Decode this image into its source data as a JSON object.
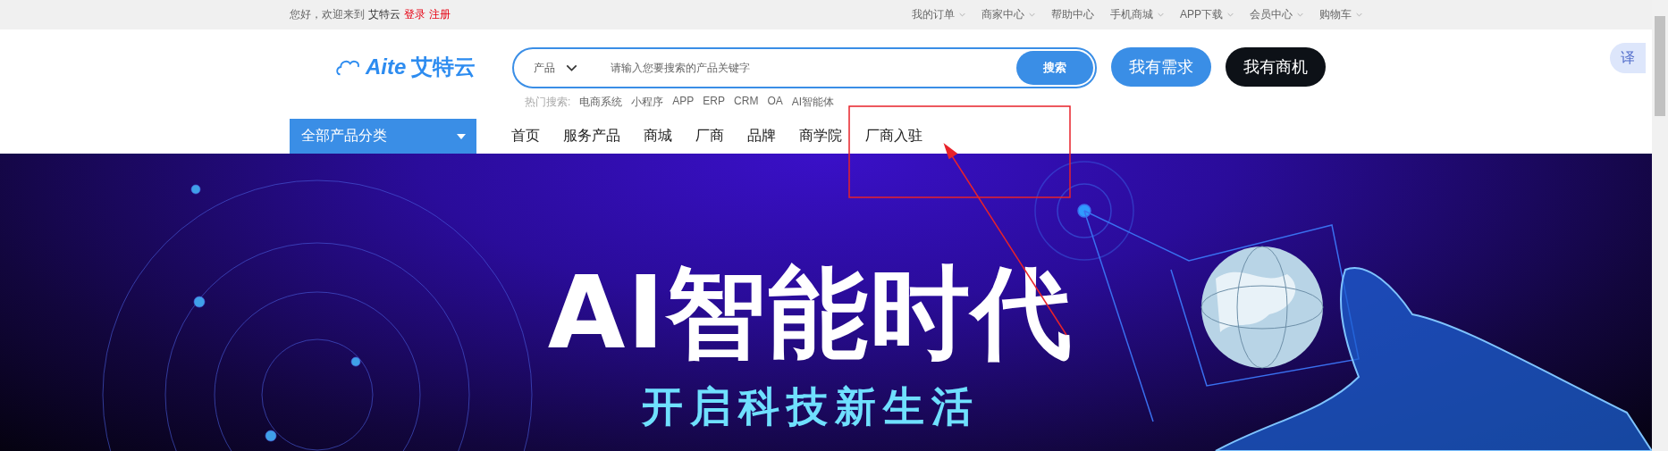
{
  "top_bar": {
    "greeting": "您好，欢迎来到",
    "site_name": "艾特云",
    "login": "登录",
    "register": "注册",
    "links": [
      {
        "label": "我的订单",
        "has_menu": true
      },
      {
        "label": "商家中心",
        "has_menu": true
      },
      {
        "label": "帮助中心",
        "has_menu": false
      },
      {
        "label": "手机商城",
        "has_menu": true
      },
      {
        "label": "APP下载",
        "has_menu": true
      },
      {
        "label": "会员中心",
        "has_menu": true
      },
      {
        "label": "购物车",
        "has_menu": true
      }
    ]
  },
  "logo": {
    "latin": "Aite",
    "name": "艾特云"
  },
  "search": {
    "category": "产品",
    "placeholder": "请输入您要搜索的产品关键字",
    "button": "搜索",
    "hot_label": "热门搜索:",
    "hot_terms": [
      "电商系统",
      "小程序",
      "APP",
      "ERP",
      "CRM",
      "OA",
      "AI智能体"
    ]
  },
  "header_buttons": [
    {
      "label": "我有需求",
      "kind": "primary"
    },
    {
      "label": "我有商机",
      "kind": "dark"
    }
  ],
  "translate_button": "译",
  "category_menu": {
    "label": "全部产品分类"
  },
  "nav": [
    "首页",
    "服务产品",
    "商城",
    "厂商",
    "品牌",
    "商学院",
    "厂商入驻"
  ],
  "banner": {
    "title": "AI智能时代",
    "subtitle": "开启科技新生活"
  }
}
